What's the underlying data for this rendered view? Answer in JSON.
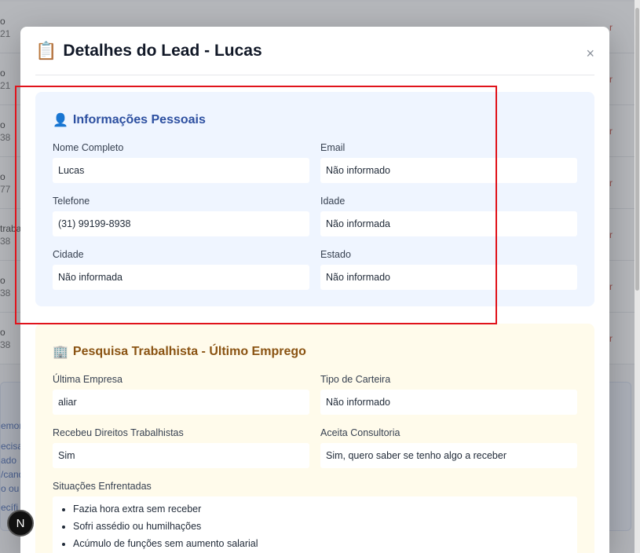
{
  "background": {
    "rows": [
      {
        "l1": "o",
        "l2": "21",
        "action": "r"
      },
      {
        "l1": "o",
        "l2": "21",
        "action": "r"
      },
      {
        "l1": "o",
        "l2": "38",
        "action": "r"
      },
      {
        "l1": "o",
        "l2": "77",
        "action": "r"
      },
      {
        "l1": "traba",
        "l2": "38",
        "action": "r"
      },
      {
        "l1": "o",
        "l2": "38",
        "action": "r"
      },
      {
        "l1": "o",
        "l2": "38",
        "action": "r"
      }
    ],
    "card_lines": [
      "emor",
      "ecisa",
      "ado",
      "/cand",
      "o ou",
      "ecífi"
    ]
  },
  "fab_label": "N",
  "modal": {
    "title": "Detalhes do Lead - Lucas",
    "close_label": "×",
    "personal": {
      "title": "Informações Pessoais",
      "fields": [
        {
          "label": "Nome Completo",
          "value": "Lucas"
        },
        {
          "label": "Email",
          "value": "Não informado"
        },
        {
          "label": "Telefone",
          "value": "(31) 99199-8938"
        },
        {
          "label": "Idade",
          "value": "Não informada"
        },
        {
          "label": "Cidade",
          "value": "Não informada"
        },
        {
          "label": "Estado",
          "value": "Não informado"
        }
      ]
    },
    "work": {
      "title": "Pesquisa Trabalhista - Último Emprego",
      "fields": [
        {
          "label": "Última Empresa",
          "value": "aliar"
        },
        {
          "label": "Tipo de Carteira",
          "value": "Não informado"
        },
        {
          "label": "Recebeu Direitos Trabalhistas",
          "value": "Sim"
        },
        {
          "label": "Aceita Consultoria",
          "value": "Sim, quero saber se tenho algo a receber"
        }
      ],
      "situations_label": "Situações Enfrentadas",
      "situations": [
        "Fazia hora extra sem receber",
        "Sofri assédio ou humilhações",
        "Acúmulo de funções sem aumento salarial"
      ]
    }
  },
  "colors": {
    "highlight": "#e0131b",
    "personal_bg": "#eff5ff",
    "work_bg": "#fffbeb"
  }
}
